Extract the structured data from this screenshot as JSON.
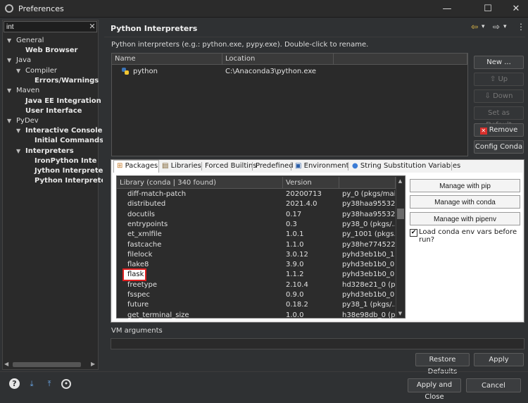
{
  "window": {
    "title": "Preferences",
    "minimize_glyph": "—",
    "maximize_glyph": "☐",
    "close_glyph": "✕"
  },
  "filter": {
    "value": "int",
    "clear_glyph": "✕"
  },
  "tree": {
    "general": "General",
    "web_browser": "Web Browser",
    "java": "Java",
    "compiler": "Compiler",
    "errors_warnings": "Errors/Warnings",
    "maven": "Maven",
    "java_ee": "Java EE Integration",
    "user_interface": "User Interface",
    "pydev": "PyDev",
    "interactive_console": "Interactive Console",
    "initial_commands": "Initial Commands",
    "interpreters": "Interpreters",
    "ironpython": "IronPython Interpre",
    "jython": "Jython Interpreter",
    "python": "Python Interpreter"
  },
  "header": {
    "title": "Python Interpreters",
    "back_glyph": "⇦",
    "forward_glyph": "⇨",
    "dropdown_glyph": "▾",
    "menu_glyph": "⋮"
  },
  "description": "Python interpreters (e.g.: python.exe, pypy.exe).   Double-click to rename.",
  "interpreters": {
    "columns": [
      "Name",
      "Location"
    ],
    "rows": [
      {
        "name": "python",
        "location": "C:\\Anaconda3\\python.exe"
      }
    ]
  },
  "side_buttons": {
    "new": "New ...",
    "up": "Up",
    "down": "Down",
    "set_default": "Set as Default",
    "remove": "Remove",
    "config_conda": "Config Conda"
  },
  "tabs": [
    "Packages",
    "Libraries",
    "Forced Builtins",
    "Predefined",
    "Environment",
    "String Substitution Variables"
  ],
  "packages": {
    "columns": [
      "Library (conda | 340 found)",
      "Version",
      ""
    ],
    "rows": [
      {
        "name": "diff-match-patch",
        "version": "20200713",
        "build": "py_0 (pkgs/mai..."
      },
      {
        "name": "distributed",
        "version": "2021.4.0",
        "build": "py38haa95532..."
      },
      {
        "name": "docutils",
        "version": "0.17",
        "build": "py38haa95532..."
      },
      {
        "name": "entrypoints",
        "version": "0.3",
        "build": "py38_0 (pkgs/..."
      },
      {
        "name": "et_xmlfile",
        "version": "1.0.1",
        "build": "py_1001 (pkgs..."
      },
      {
        "name": "fastcache",
        "version": "1.1.0",
        "build": "py38he774522..."
      },
      {
        "name": "filelock",
        "version": "3.0.12",
        "build": "pyhd3eb1b0_1..."
      },
      {
        "name": "flake8",
        "version": "3.9.0",
        "build": "pyhd3eb1b0_0..."
      },
      {
        "name": "flask",
        "version": "1.1.2",
        "build": "pyhd3eb1b0_0..."
      },
      {
        "name": "freetype",
        "version": "2.10.4",
        "build": "hd328e21_0 (p..."
      },
      {
        "name": "fsspec",
        "version": "0.9.0",
        "build": "pyhd3eb1b0_0..."
      },
      {
        "name": "future",
        "version": "0.18.2",
        "build": "py38_1 (pkgs/..."
      },
      {
        "name": "get_terminal_size",
        "version": "1.0.0",
        "build": "h38e98db_0 (p..."
      }
    ]
  },
  "package_buttons": {
    "pip": "Manage with pip",
    "conda": "Manage with conda",
    "pipenv": "Manage with pipenv",
    "load_conda": "Load conda env vars before run?"
  },
  "vm_arguments": {
    "label": "VM arguments",
    "value": ""
  },
  "footer": {
    "restore_defaults": "Restore Defaults",
    "apply": "Apply",
    "apply_close": "Apply and Close",
    "cancel": "Cancel"
  }
}
